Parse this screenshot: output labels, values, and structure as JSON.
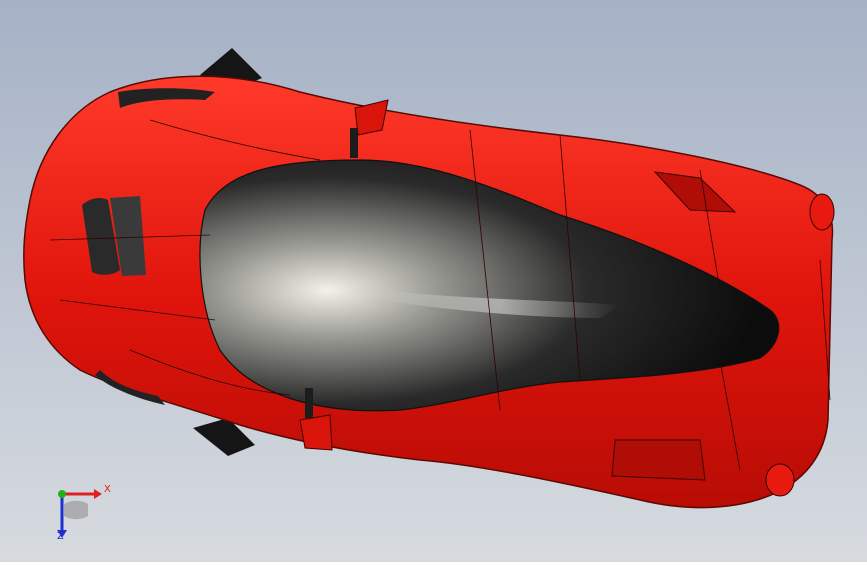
{
  "viewport": {
    "background_top": "#a5b1c5",
    "background_bottom": "#d7dbe0",
    "model": "red-car-top-view",
    "model_color": "#e0150c",
    "canopy_color": "#1a1a1a"
  },
  "triad": {
    "x_label": "X",
    "z_label": "Z",
    "x_color": "#e02020",
    "y_color": "#20b020",
    "z_color": "#2030d0"
  }
}
